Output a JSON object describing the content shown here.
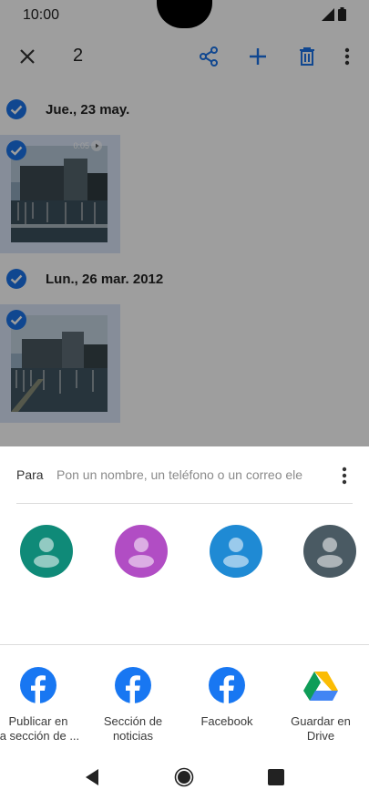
{
  "status": {
    "time": "10:00"
  },
  "toolbar": {
    "selected_count": "2",
    "icons": [
      "close-icon",
      "share-icon",
      "add-icon",
      "delete-icon",
      "more-vert-icon"
    ],
    "accent": "#1a73e8"
  },
  "groups": [
    {
      "date": "Jue., 23 may.",
      "items": [
        {
          "type": "video",
          "duration": "0:05"
        }
      ]
    },
    {
      "date": "Lun., 26 mar. 2012",
      "items": [
        {
          "type": "photo"
        }
      ]
    }
  ],
  "share": {
    "to_label": "Para",
    "to_placeholder": "Pon un nombre, un teléfono o un correo ele",
    "contacts": [
      {
        "color": "#0f8a78"
      },
      {
        "color": "#b14dc4"
      },
      {
        "color": "#1f8ad4"
      },
      {
        "color": "#4a5a63"
      }
    ],
    "apps": [
      {
        "label": "Publicar en\nla sección de ...",
        "icon": "facebook-icon"
      },
      {
        "label": "Sección de\nnoticias",
        "icon": "facebook-icon"
      },
      {
        "label": "Facebook",
        "icon": "facebook-icon"
      },
      {
        "label": "Guardar en\nDrive",
        "icon": "google-drive-icon"
      }
    ]
  },
  "nav": {
    "icons": [
      "back-icon",
      "home-icon",
      "recents-icon"
    ]
  }
}
